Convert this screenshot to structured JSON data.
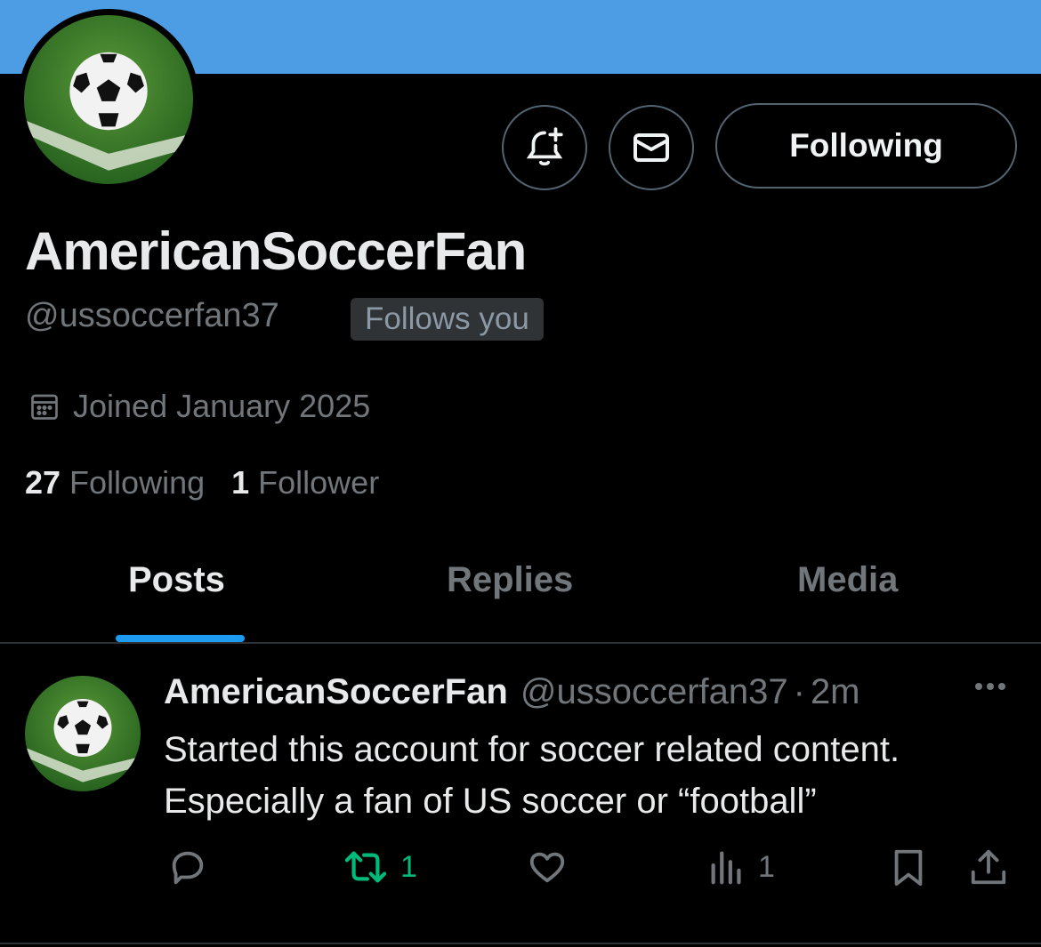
{
  "header": {
    "follow_button_label": "Following"
  },
  "profile": {
    "display_name": "AmericanSoccerFan",
    "handle": "@ussoccerfan37",
    "follows_you_badge": "Follows you",
    "joined": "Joined January 2025",
    "following_count": "27",
    "following_label": "Following",
    "followers_count": "1",
    "followers_label": "Follower"
  },
  "tabs": [
    {
      "label": "Posts",
      "active": true
    },
    {
      "label": "Replies",
      "active": false
    },
    {
      "label": "Media",
      "active": false
    }
  ],
  "post": {
    "author_name": "AmericanSoccerFan",
    "author_handle": "@ussoccerfan37",
    "separator": "·",
    "time": "2m",
    "text": "Started this account for soccer related content. Especially a fan of US soccer or “football”",
    "reply_count": "",
    "repost_count": "1",
    "like_count": "",
    "view_count": "1"
  },
  "colors": {
    "banner": "#4c9de3",
    "accent": "#1d9bf0",
    "repost_active": "#00ba7c",
    "muted_text": "#71767b",
    "background": "#000000"
  },
  "icons": {
    "notify": "bell-plus-icon",
    "message": "envelope-icon",
    "joined": "calendar-icon",
    "reply": "reply-icon",
    "repost": "repost-icon",
    "like": "heart-icon",
    "views": "views-chart-icon",
    "bookmark": "bookmark-icon",
    "share": "share-icon",
    "more": "more-dots-icon"
  }
}
